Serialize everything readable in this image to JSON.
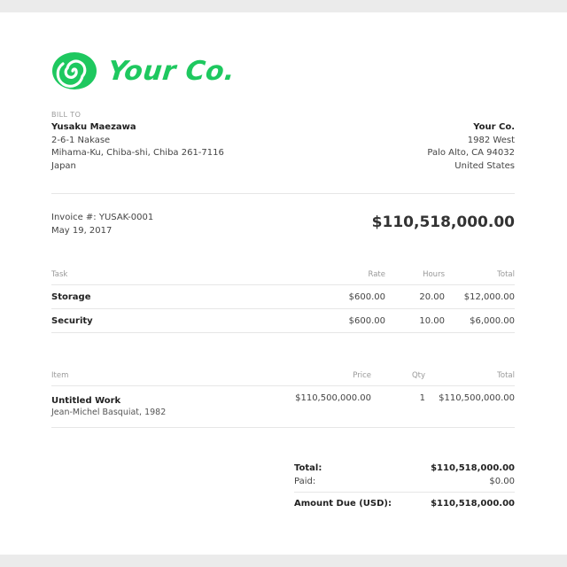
{
  "brand": {
    "logo_text": "Your Co.",
    "accent_color": "#1ec85f",
    "logo_icon": "swirl-icon"
  },
  "bill_to": {
    "label": "BILL TO",
    "name": "Yusaku Maezawa",
    "line1": "2-6-1 Nakase",
    "line2": "Mihama-Ku, Chiba-shi, Chiba 261-7116",
    "line3": "Japan"
  },
  "from": {
    "name": "Your Co.",
    "line1": "1982 West",
    "line2": "Palo Alto, CA 94032",
    "line3": "United States"
  },
  "invoice": {
    "number": "Invoice #: YUSAK-0001",
    "date": "May 19, 2017",
    "total": "$110,518,000.00"
  },
  "tasks": {
    "headers": [
      "Task",
      "Rate",
      "Hours",
      "Total"
    ],
    "rows": [
      {
        "task": "Storage",
        "rate": "$600.00",
        "hours": "20.00",
        "total": "$12,000.00"
      },
      {
        "task": "Security",
        "rate": "$600.00",
        "hours": "10.00",
        "total": "$6,000.00"
      }
    ]
  },
  "items": {
    "headers": [
      "Item",
      "Price",
      "Qty",
      "Total"
    ],
    "rows": [
      {
        "item": "Untitled Work",
        "description": "Jean-Michel Basquiat, 1982",
        "price": "$110,500,000.00",
        "qty": "1",
        "total": "$110,500,000.00"
      }
    ]
  },
  "summary": {
    "total_label": "Total:",
    "total_value": "$110,518,000.00",
    "paid_label": "Paid:",
    "paid_value": "$0.00",
    "due_label": "Amount Due (USD):",
    "due_value": "$110,518,000.00"
  }
}
